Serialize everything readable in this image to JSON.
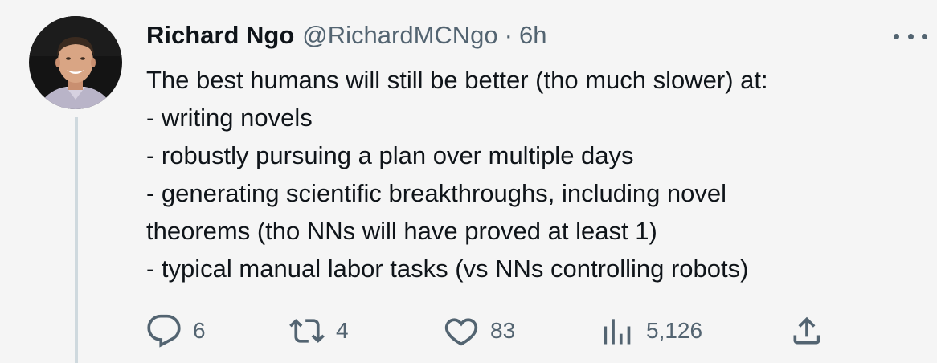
{
  "tweet": {
    "author_name": "Richard Ngo",
    "author_handle": "@RichardMCNgo",
    "separator": "·",
    "time": "6h",
    "lines": [
      "The best humans will still be better (tho much slower) at:",
      "- writing novels",
      "- robustly pursuing a plan over multiple days",
      "- generating scientific breakthroughs, including novel",
      "theorems (tho NNs will have proved at least 1)",
      "- typical manual labor tasks (vs NNs controlling robots)"
    ]
  },
  "actions": {
    "replies": "6",
    "retweets": "4",
    "likes": "83",
    "views": "5,126"
  },
  "icons": {
    "reply": "reply-icon",
    "retweet": "retweet-icon",
    "like": "heart-icon",
    "views": "views-icon",
    "share": "share-icon",
    "more": "more-icon"
  },
  "colors": {
    "text_primary": "#0f1419",
    "text_secondary": "#536471",
    "thread_line": "#cfd9de",
    "background": "#f5f5f5"
  }
}
